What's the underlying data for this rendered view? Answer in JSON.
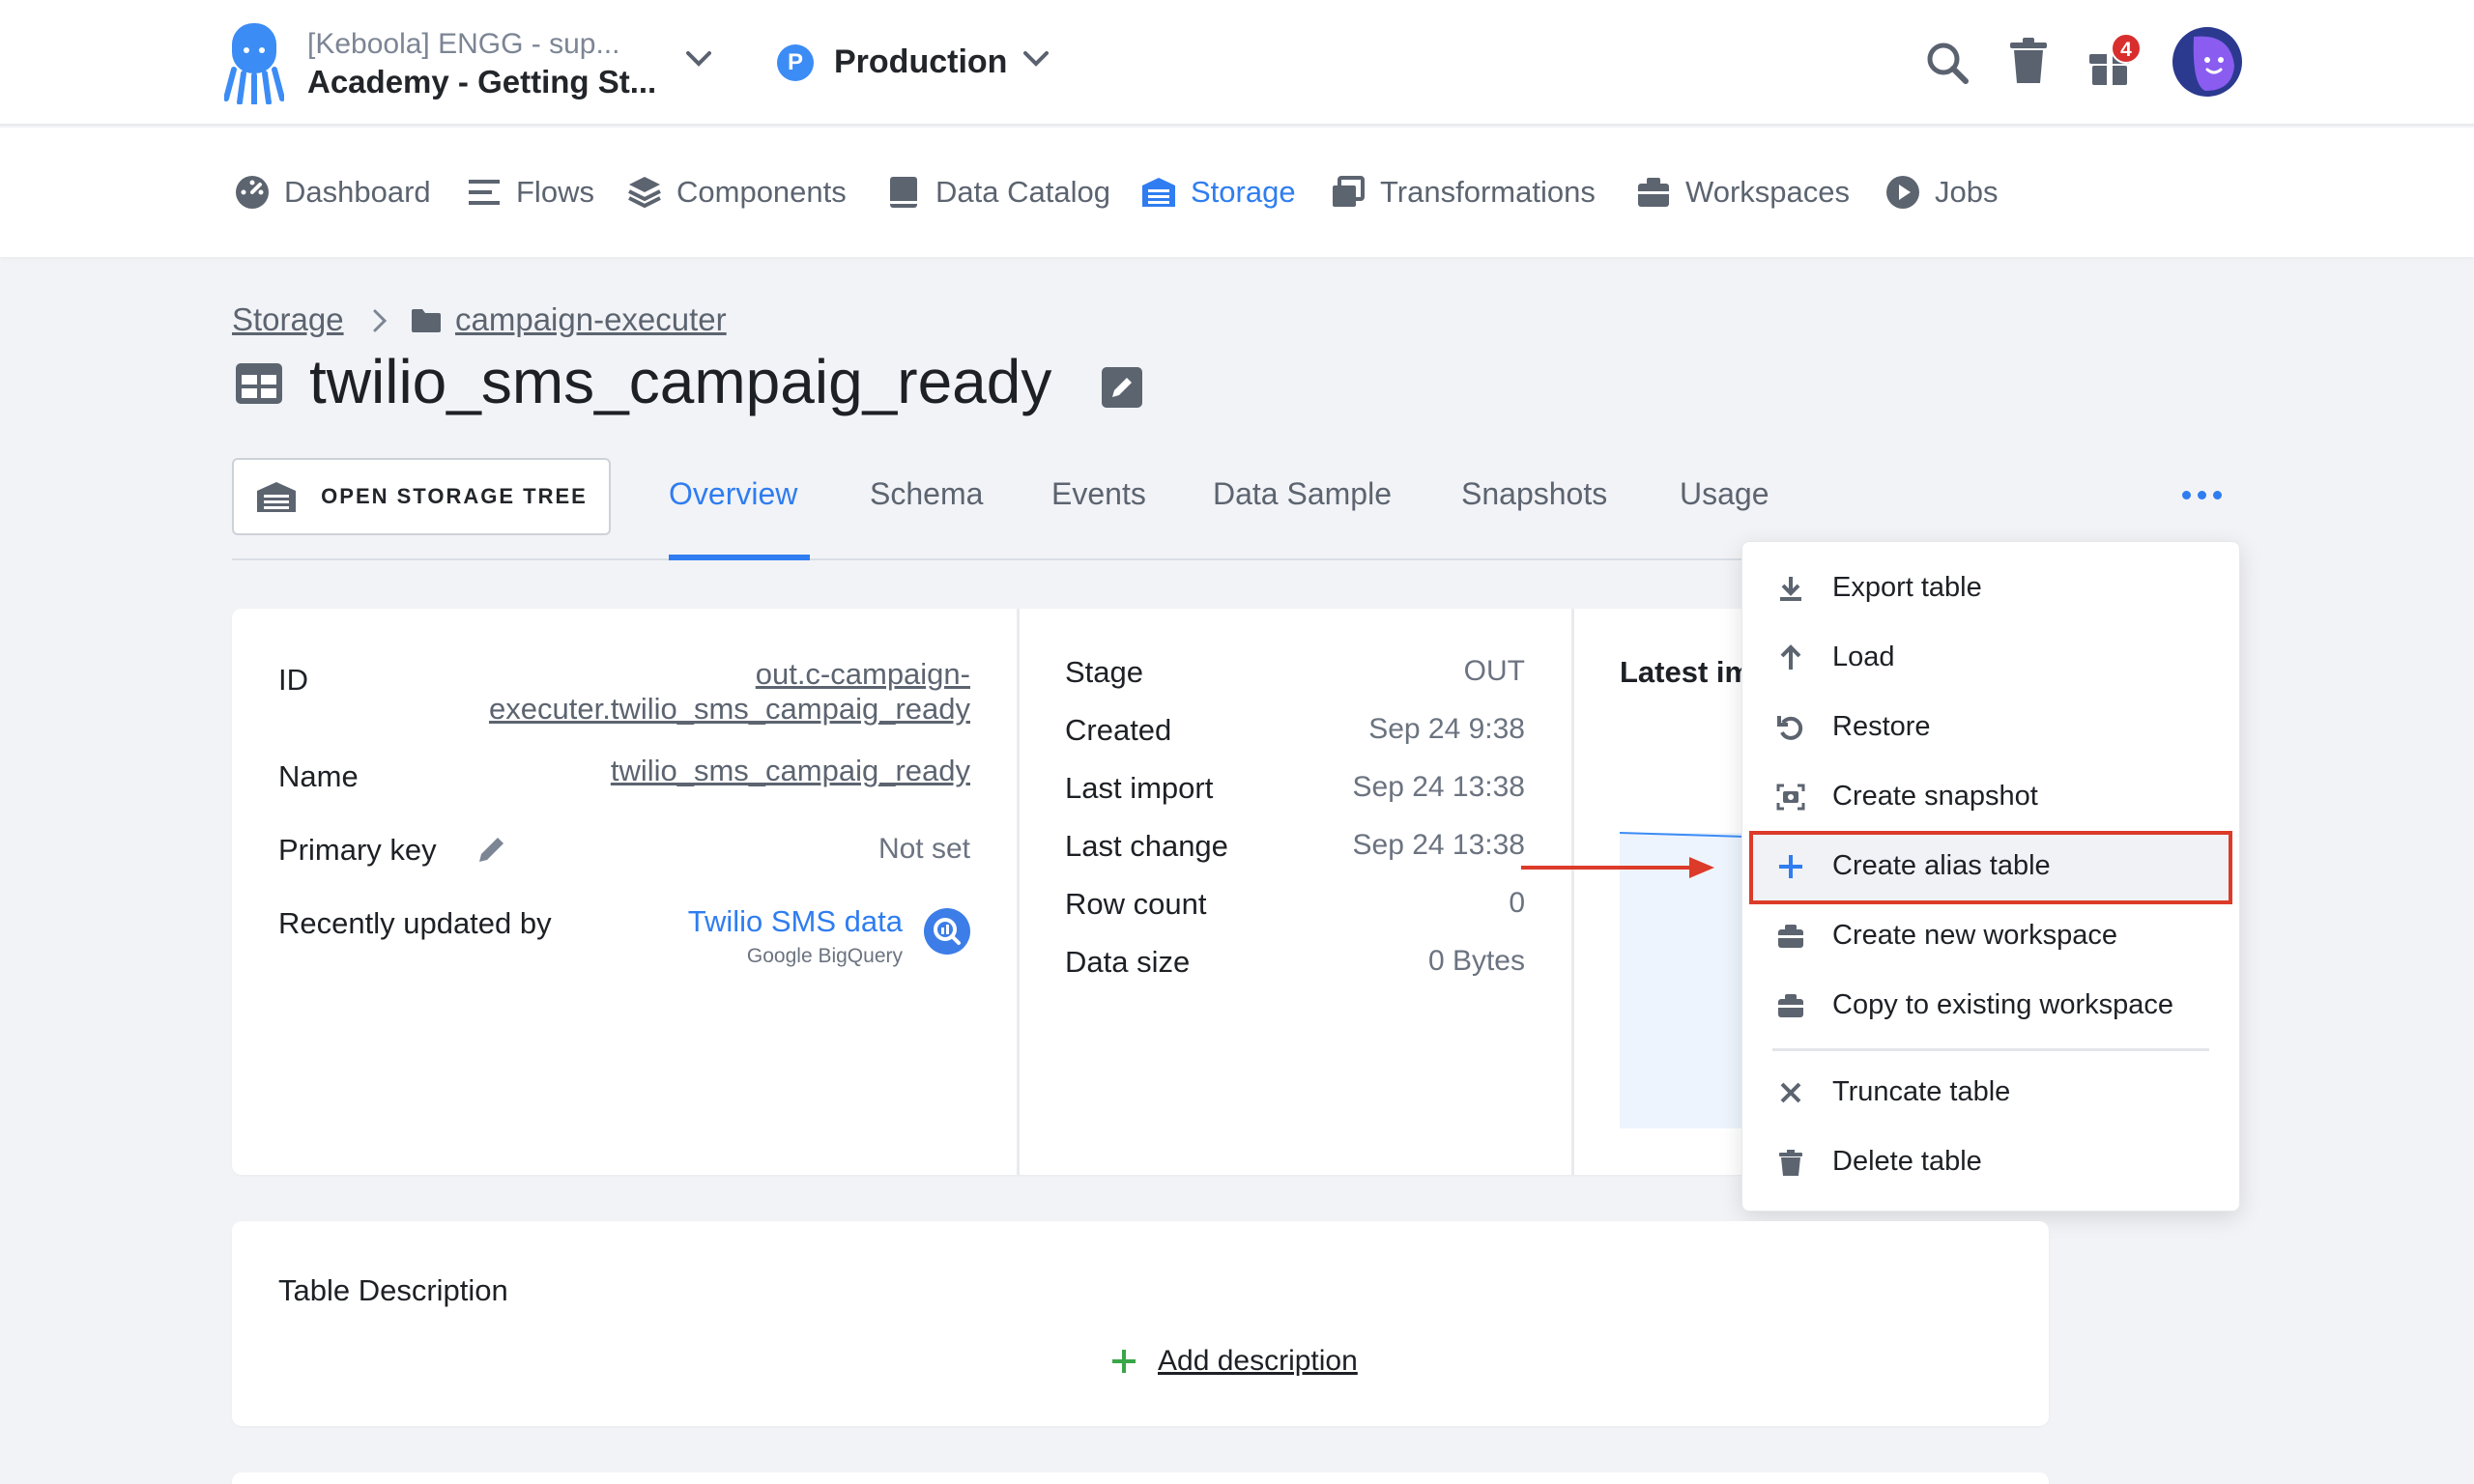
{
  "header": {
    "project_subtitle": "[Keboola] ENGG - sup...",
    "project_title": "Academy - Getting St...",
    "environment_badge": "P",
    "environment_label": "Production",
    "notifications_count": "4"
  },
  "nav": {
    "items": [
      {
        "label": "Dashboard",
        "icon": "dashboard-icon"
      },
      {
        "label": "Flows",
        "icon": "flows-icon"
      },
      {
        "label": "Components",
        "icon": "components-icon"
      },
      {
        "label": "Data Catalog",
        "icon": "data-catalog-icon"
      },
      {
        "label": "Storage",
        "icon": "storage-icon",
        "active": true
      },
      {
        "label": "Transformations",
        "icon": "transformations-icon"
      },
      {
        "label": "Workspaces",
        "icon": "workspaces-icon"
      },
      {
        "label": "Jobs",
        "icon": "jobs-icon"
      }
    ]
  },
  "breadcrumb": {
    "root": "Storage",
    "bucket": "campaign-executer"
  },
  "page": {
    "title": "twilio_sms_campaig_ready"
  },
  "toolbar": {
    "open_storage_tree": "OPEN STORAGE TREE"
  },
  "tabs": [
    "Overview",
    "Schema",
    "Events",
    "Data Sample",
    "Snapshots",
    "Usage"
  ],
  "details": {
    "id_label": "ID",
    "id_value_line1": "out.c-campaign-",
    "id_value_line2": "executer.twilio_sms_campaig_ready",
    "name_label": "Name",
    "name_value": "twilio_sms_campaig_ready",
    "primary_key_label": "Primary key",
    "primary_key_value": "Not set",
    "updated_by_label": "Recently updated by",
    "updated_by_value": "Twilio SMS data",
    "updated_by_sub": "Google BigQuery"
  },
  "stats": [
    {
      "label": "Stage",
      "value": "OUT"
    },
    {
      "label": "Created",
      "value": "Sep 24 9:38"
    },
    {
      "label": "Last import",
      "value": "Sep 24 13:38"
    },
    {
      "label": "Last change",
      "value": "Sep 24 13:38"
    },
    {
      "label": "Row count",
      "value": "0"
    },
    {
      "label": "Data size",
      "value": "0 Bytes"
    }
  ],
  "chart_panel": {
    "title_partial": "Latest im"
  },
  "menu": {
    "items": [
      {
        "label": "Export table",
        "icon": "download-icon"
      },
      {
        "label": "Load",
        "icon": "arrow-up-icon"
      },
      {
        "label": "Restore",
        "icon": "restore-icon"
      },
      {
        "label": "Create snapshot",
        "icon": "camera-icon"
      },
      {
        "label": "Create alias table",
        "icon": "plus-icon",
        "highlighted": true
      },
      {
        "label": "Create new workspace",
        "icon": "workspace-icon"
      },
      {
        "label": "Copy to existing workspace",
        "icon": "workspace-icon"
      },
      {
        "label": "Truncate table",
        "icon": "x-icon"
      },
      {
        "label": "Delete table",
        "icon": "trash-icon"
      }
    ]
  },
  "description": {
    "heading": "Table Description",
    "add_label": "Add description"
  },
  "colors": {
    "accent": "#2f7df0",
    "highlight_border": "#dc3b2a",
    "add_green": "#3aa648"
  }
}
